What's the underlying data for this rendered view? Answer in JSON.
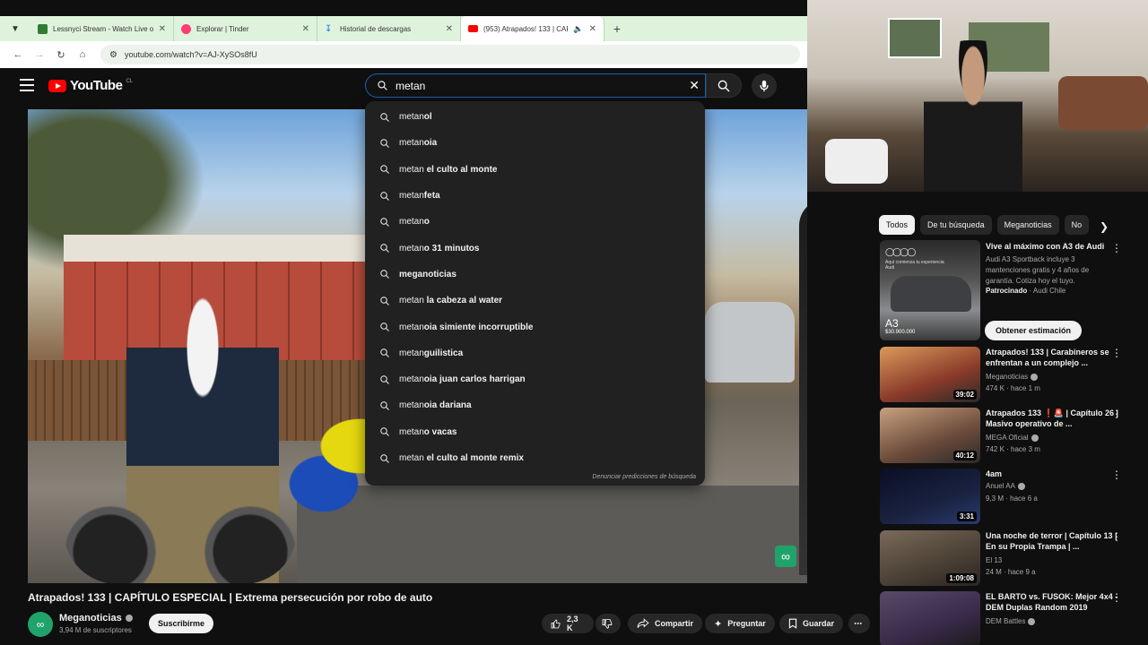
{
  "browser": {
    "tabs": [
      {
        "title": "Lessnyci Stream - Watch Live o",
        "favicon_color": "#2e7d32",
        "active": false
      },
      {
        "title": "Explorar | Tinder",
        "favicon_color": "#fe3c72",
        "active": false
      },
      {
        "title": "Historial de descargas",
        "favicon_color": "#1a73e8",
        "active": false
      },
      {
        "title": "(953) Atrapados! 133 | CAP",
        "favicon_color": "#ff0000",
        "active": true
      }
    ],
    "url": "youtube.com/watch?v=AJ-XySOs8fU"
  },
  "header": {
    "logo_text": "YouTube",
    "logo_region": "CL",
    "search_value": "metan",
    "search_placeholder": "Buscar"
  },
  "suggestions": {
    "query_prefix": "metan",
    "items": [
      {
        "prefix": "metan",
        "rest": "ol"
      },
      {
        "prefix": "metan",
        "rest": "oia"
      },
      {
        "prefix": "metan",
        "rest": " el culto al monte"
      },
      {
        "prefix": "metan",
        "rest": "feta"
      },
      {
        "prefix": "metan",
        "rest": "o"
      },
      {
        "prefix": "metan",
        "rest": "o 31 minutos"
      },
      {
        "prefix": "",
        "rest": "meganoticias"
      },
      {
        "prefix": "metan",
        "rest": " la cabeza al water"
      },
      {
        "prefix": "metan",
        "rest": "oia simiente incorruptible"
      },
      {
        "prefix": "metan",
        "rest": "guilistica"
      },
      {
        "prefix": "metan",
        "rest": "oia juan carlos harrigan"
      },
      {
        "prefix": "metan",
        "rest": "oia dariana"
      },
      {
        "prefix": "metan",
        "rest": "o vacas"
      },
      {
        "prefix": "metan",
        "rest": " el culto al monte remix"
      }
    ],
    "report_label": "Denunciar predicciones de búsqueda"
  },
  "video": {
    "title": "Atrapados! 133 | CAPÍTULO ESPECIAL | Extrema persecución por robo de auto",
    "channel": "Meganoticias",
    "subscribers": "3,94 M de suscriptores",
    "subscribe_label": "Suscribirme",
    "likes": "2,3 K",
    "share_label": "Compartir",
    "ask_label": "Preguntar",
    "save_label": "Guardar"
  },
  "sidebar": {
    "chips": [
      "Todos",
      "De tu búsqueda",
      "Meganoticias",
      "No"
    ],
    "ad": {
      "title": "Vive al máximo con A3 de Audi",
      "description": "Audi A3 Sportback incluye 3 mantenciones gratis y 4 años de garantía. Cotiza hoy el tuyo.",
      "sponsored": "Patrocinado",
      "advertiser": "Audi Chile",
      "cta": "Obtener estimación",
      "thumb_text": "Aquí comienza tu experiencia Audi",
      "thumb_model": "A3",
      "thumb_price": "$30.900.000"
    },
    "recommendations": [
      {
        "title": "Atrapados! 133 | Carabineros se enfrentan a un complejo ...",
        "channel": "Meganoticias",
        "views": "474 K",
        "age": "hace 1 m",
        "duration": "39:02",
        "thumb_color": "#8a3a2a"
      },
      {
        "title": "Atrapados 133 ❗🚨 | Capítulo 26 | Masivo operativo de ...",
        "channel": "MEGA Oficial",
        "views": "742 K",
        "age": "hace 3 m",
        "duration": "40:12",
        "thumb_color": "#6a4a3a"
      },
      {
        "title": "4am",
        "channel": "Anuel AA",
        "views": "9,3 M",
        "age": "hace 6 a",
        "duration": "3:31",
        "thumb_color": "#1a2240"
      },
      {
        "title": "Una noche de terror | Capítulo 13 | En su Propia Trampa | ...",
        "channel": "El 13",
        "views": "24 M",
        "age": "hace 9 a",
        "duration": "1:09:08",
        "thumb_color": "#4a4035"
      },
      {
        "title": "EL BARTO vs. FUSOK: Mejor 4x4 - DEM Duplas Random 2019",
        "channel": "DEM Battles",
        "views": "",
        "age": "",
        "duration": "",
        "thumb_color": "#3a2a4a"
      }
    ]
  }
}
